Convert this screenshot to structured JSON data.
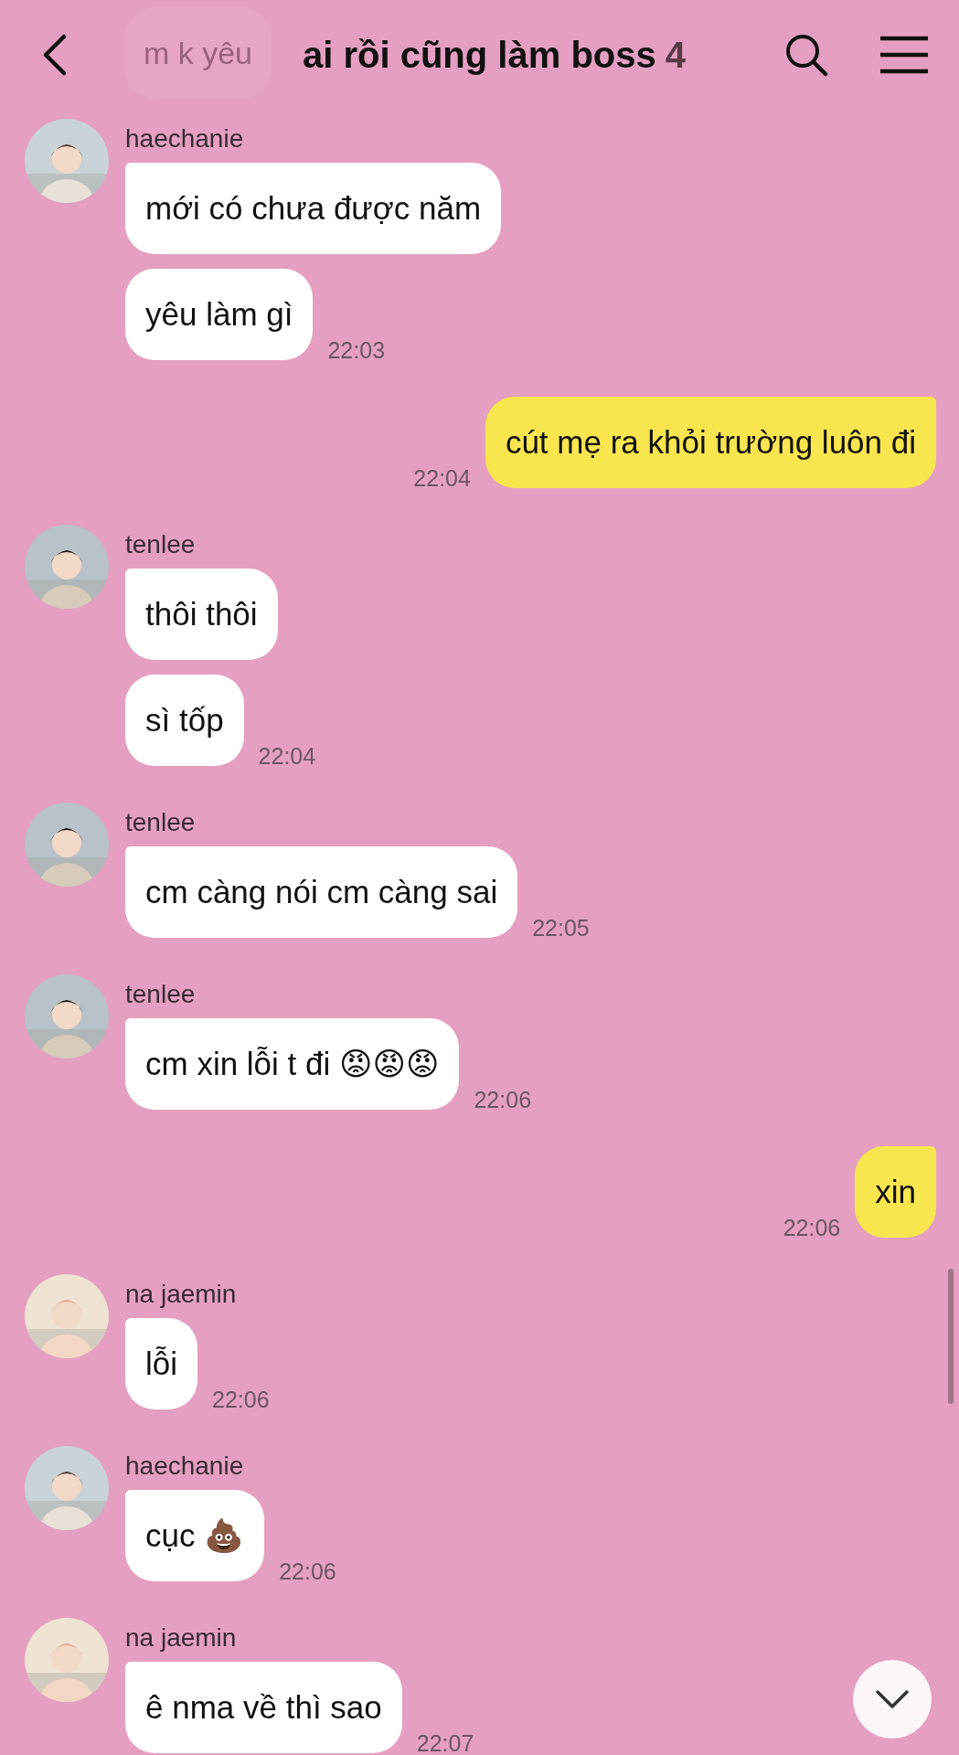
{
  "header": {
    "title": "ai rồi cũng làm boss",
    "member_count": "4"
  },
  "faded_message": {
    "text": "m k yêu"
  },
  "messages": [
    {
      "kind": "incoming",
      "sender": "haechanie",
      "avatar": {
        "kind": "picture"
      },
      "bubbles": [
        "mới có chưa được năm",
        "yêu làm gì"
      ],
      "time": "22:03"
    },
    {
      "kind": "outgoing",
      "bubbles": [
        "cút mẹ ra khỏi trường luôn đi"
      ],
      "time": "22:04"
    },
    {
      "kind": "incoming",
      "sender": "tenlee",
      "avatar": {
        "kind": "picture"
      },
      "bubbles": [
        "thôi thôi",
        "sì tốp"
      ],
      "time": "22:04"
    },
    {
      "kind": "incoming",
      "sender": "tenlee",
      "avatar": {
        "kind": "picture"
      },
      "bubbles": [
        "cm càng nói cm càng sai"
      ],
      "time": "22:05"
    },
    {
      "kind": "incoming",
      "sender": "tenlee",
      "avatar": {
        "kind": "picture"
      },
      "bubbles": [
        "cm xin lỗi t đi 😡😡😡"
      ],
      "time": "22:06"
    },
    {
      "kind": "outgoing",
      "bubbles": [
        "xin"
      ],
      "time": "22:06"
    },
    {
      "kind": "incoming",
      "sender": "na jaemin",
      "avatar": {
        "kind": "picture"
      },
      "bubbles": [
        "lỗi"
      ],
      "time": "22:06"
    },
    {
      "kind": "incoming",
      "sender": "haechanie",
      "avatar": {
        "kind": "picture"
      },
      "bubbles": [
        "cục 💩"
      ],
      "time": "22:06"
    },
    {
      "kind": "incoming",
      "sender": "na jaemin",
      "avatar": {
        "kind": "picture"
      },
      "bubbles": [
        "ê nma về thì sao"
      ],
      "time": "22:07"
    }
  ]
}
